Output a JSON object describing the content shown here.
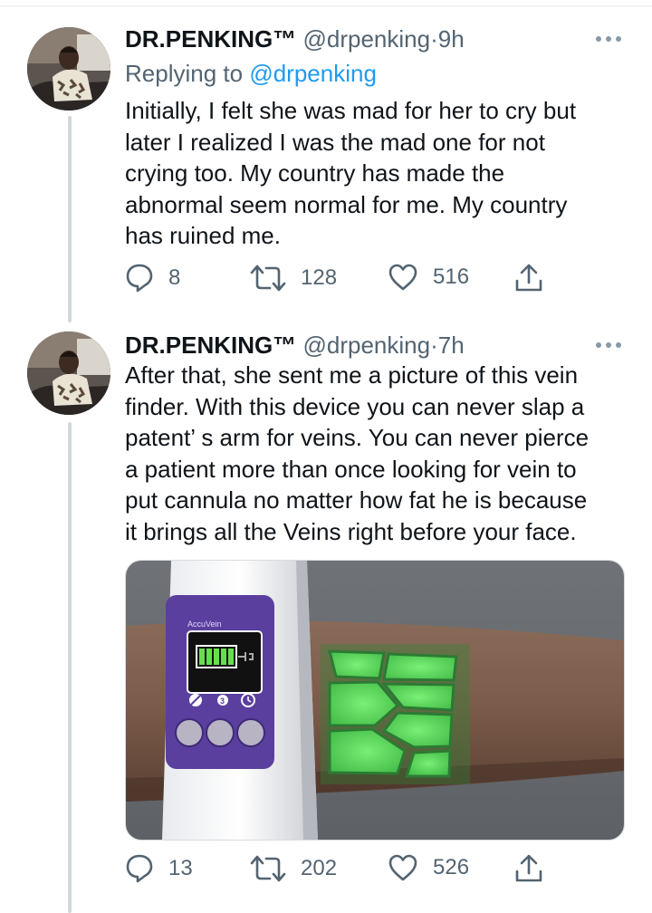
{
  "tweets": [
    {
      "name": "DR.PENKING™",
      "handle": "@drpenking",
      "time_sep": "·",
      "time": "9h",
      "replying_prefix": "Replying to",
      "replying_handle": "@drpenking",
      "text": "Initially, I felt she was mad for her to cry but\nlater I realized I was the mad one for not\ncrying too. My country has made the\nabnormal seem normal for me. My country\nhas ruined me.",
      "replies": "8",
      "retweets": "128",
      "likes": "516"
    },
    {
      "name": "DR.PENKING™",
      "handle": "@drpenking",
      "time_sep": "·",
      "time": "7h",
      "text": "After that, she sent me a picture of this vein\nfinder. With this device you can never slap a\npatent’ s arm for veins. You can never pierce\na patient more than once looking for vein to\nput cannula no matter how fat he is because\nit brings all the Veins right before your face.",
      "media_brand": "AccuVein",
      "media_button_number": "3",
      "replies": "13",
      "retweets": "202",
      "likes": "526"
    }
  ],
  "icons": {
    "reply": "reply-icon",
    "retweet": "retweet-icon",
    "like": "heart-icon",
    "share": "share-icon",
    "more": "more-icon"
  },
  "colors": {
    "link": "#1d9bf0",
    "secondary_text": "#536471",
    "thread_line": "#cfd9de",
    "vein_green": "#39e65a",
    "device_purple": "#5a3f9e"
  }
}
